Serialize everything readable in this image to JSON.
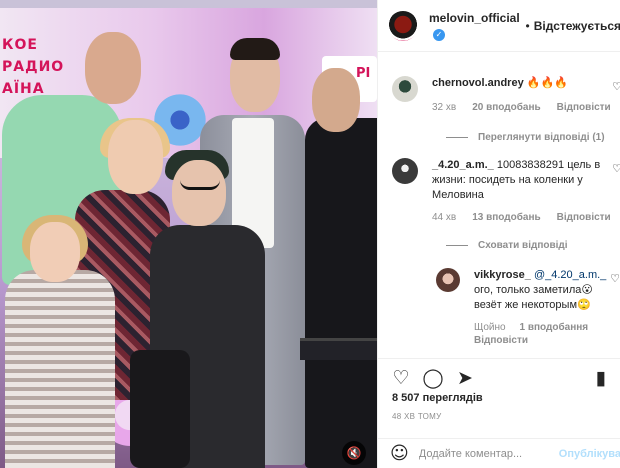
{
  "colors": {
    "accent": "#3897f0",
    "text": "#262626",
    "muted": "#8e8e8e",
    "publish_disabled": "#b2dffc",
    "banner_text": "#d4145a"
  },
  "photo": {
    "banner_left": "КОЕ РАДИО АЇНА",
    "banner_right": "РІ",
    "sound_icon": "speaker-muted-icon"
  },
  "header": {
    "username": "melovin_official",
    "verified_icon": "verified-badge-icon",
    "separator": "•",
    "follow_label": "Відстежується"
  },
  "comments": [
    {
      "username": "chernovol.andrey",
      "text": "🔥🔥🔥",
      "time": "32 хв",
      "likes": "20 вподобань",
      "reply_label": "Відповісти",
      "replies_toggle": "Переглянути відповіді (1)"
    },
    {
      "username": "_4.20_a.m._",
      "text": "10083838291 цель в жизни: посидеть на коленки у Меловина",
      "time": "44 хв",
      "likes": "13 вподобань",
      "reply_label": "Відповісти",
      "replies_toggle": "Сховати відповіді"
    }
  ],
  "reply": {
    "username": "vikkyrose_",
    "mention": "@_4.20_a.m._",
    "text": "ого, только заметила😮 везёт же некоторым🙄",
    "time": "Щойно",
    "likes": "1 вподобання",
    "reply_label": "Відповісти"
  },
  "actions": {
    "like_icon": "heart-icon",
    "comment_icon": "comment-icon",
    "share_icon": "share-icon",
    "save_icon": "bookmark-icon"
  },
  "stats": {
    "views": "8 507 переглядів",
    "time_ago": "48 ХВ ТОМУ"
  },
  "add_comment": {
    "emoji_icon": "emoji-icon",
    "placeholder": "Додайте коментар...",
    "publish_label": "Опублікувати"
  }
}
